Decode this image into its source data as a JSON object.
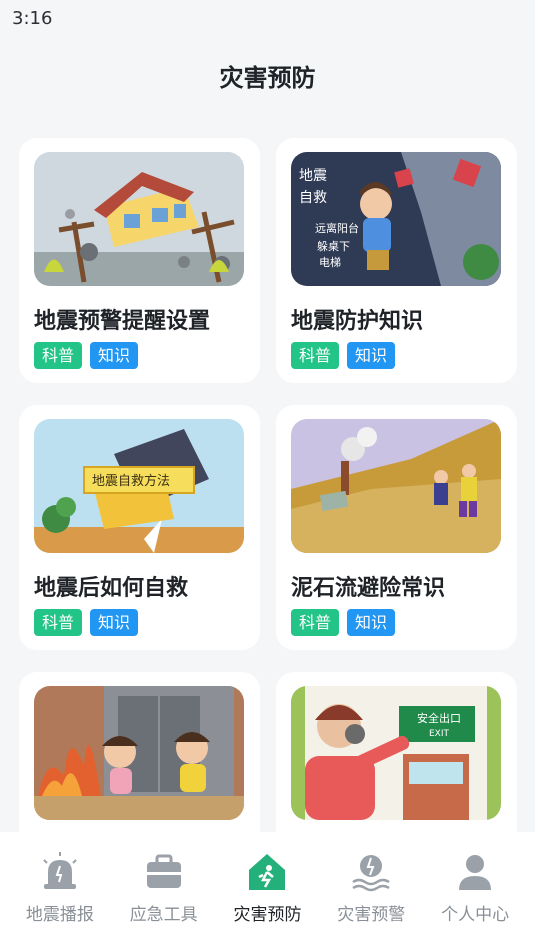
{
  "status": {
    "time": "3:16"
  },
  "header": {
    "title": "灾害预防"
  },
  "cards": [
    {
      "title": "地震预警提醒设置",
      "tags": [
        "科普",
        "知识"
      ]
    },
    {
      "title": "地震防护知识",
      "tags": [
        "科普",
        "知识"
      ],
      "thumb_text": [
        "地震",
        "自救",
        "远离阳台",
        "躲桌下",
        "电梯"
      ]
    },
    {
      "title": "地震后如何自救",
      "tags": [
        "科普",
        "知识"
      ],
      "thumb_text": "地震自救方法"
    },
    {
      "title": "泥石流避险常识",
      "tags": [
        "科普",
        "知识"
      ]
    },
    {
      "title": "",
      "tags": []
    },
    {
      "title": "",
      "tags": [],
      "thumb_text": [
        "安全出口",
        "EXIT"
      ]
    }
  ],
  "tabbar": {
    "items": [
      {
        "label": "地震播报",
        "icon": "alarm-icon"
      },
      {
        "label": "应急工具",
        "icon": "toolbox-icon"
      },
      {
        "label": "灾害预防",
        "icon": "house-run-icon",
        "active": true
      },
      {
        "label": "灾害预警",
        "icon": "warning-wave-icon"
      },
      {
        "label": "个人中心",
        "icon": "person-icon"
      }
    ]
  },
  "colors": {
    "tag_green": "#22c587",
    "tag_blue": "#2196f3",
    "active_tab": "#23b07a",
    "inactive_tab": "#8a9097"
  }
}
